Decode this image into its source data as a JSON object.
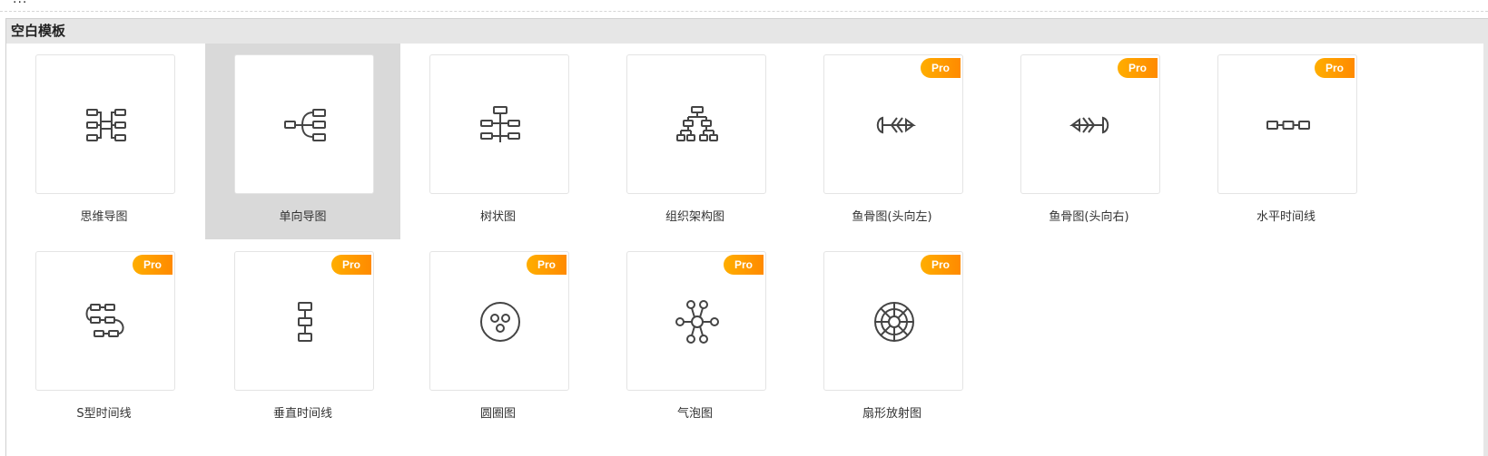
{
  "top_strip": {
    "cut_text": "..."
  },
  "panel": {
    "title": "空白模板"
  },
  "pro_label": "Pro",
  "templates": [
    {
      "label": "思维导图",
      "icon": "mind-map-icon",
      "pro": false,
      "selected": false
    },
    {
      "label": "单向导图",
      "icon": "one-way-map-icon",
      "pro": false,
      "selected": true
    },
    {
      "label": "树状图",
      "icon": "tree-chart-icon",
      "pro": false,
      "selected": false
    },
    {
      "label": "组织架构图",
      "icon": "org-chart-icon",
      "pro": false,
      "selected": false
    },
    {
      "label": "鱼骨图(头向左)",
      "icon": "fishbone-left-icon",
      "pro": true,
      "selected": false
    },
    {
      "label": "鱼骨图(头向右)",
      "icon": "fishbone-right-icon",
      "pro": true,
      "selected": false
    },
    {
      "label": "水平时间线",
      "icon": "horizontal-timeline-icon",
      "pro": true,
      "selected": false
    },
    {
      "label": "S型时间线",
      "icon": "s-timeline-icon",
      "pro": true,
      "selected": false
    },
    {
      "label": "垂直时间线",
      "icon": "vertical-timeline-icon",
      "pro": true,
      "selected": false
    },
    {
      "label": "圆圈图",
      "icon": "circle-map-icon",
      "pro": true,
      "selected": false
    },
    {
      "label": "气泡图",
      "icon": "bubble-map-icon",
      "pro": true,
      "selected": false
    },
    {
      "label": "扇形放射图",
      "icon": "radial-fan-icon",
      "pro": true,
      "selected": false
    }
  ]
}
